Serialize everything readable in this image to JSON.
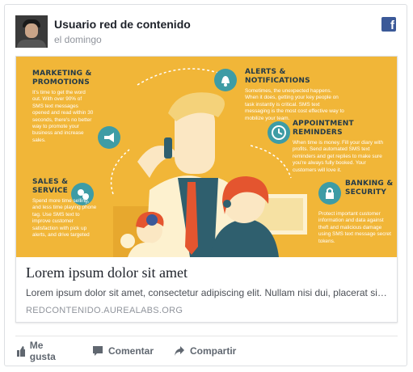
{
  "post": {
    "author": "Usuario red de contenido",
    "date": "el domingo"
  },
  "infographic": {
    "marketing_title": "MARKETING &\nPROMOTIONS",
    "marketing_text": "It's time to get the word out. With over 90% of SMS text messages opened and read within 30 seconds, there's no better way to promote your business and increase sales.",
    "alerts_title": "ALERTS & NOTIFICATIONS",
    "alerts_text": "Sometimes, the unexpected happens. When it does, getting your key people on task instantly is critical. SMS text messaging is the most cost effective way to mobilize your team.",
    "appointment_title": "APPOINTMENT REMINDERS",
    "appointment_text": "When time is money. Fill your diary with profits. Send automated SMS text reminders and get replies to make sure you're always fully booked. Your customers will love it.",
    "sales_title": "SALES &\nSERVICE",
    "sales_text": "Spend more time selling, and less time playing phone tag. Use SMS text to improve customer satisfaction with pick up alerts, and drive targeted",
    "banking_title": "BANKING &\nSECURITY",
    "banking_text": "Protect important customer information and data against theft and malicious damage using SMS text message secret tokens."
  },
  "link": {
    "title": "Lorem ipsum dolor sit amet",
    "description": "Lorem ipsum dolor sit amet, consectetur adipiscing elit. Nullam nisi dui, placerat sit amet",
    "domain": "REDCONTENIDO.AUREALABS.ORG"
  },
  "actions": {
    "like": "Me gusta",
    "comment": "Comentar",
    "share": "Compartir"
  },
  "colors": {
    "infographic_bg": "#f1b638",
    "accent_teal": "#3e9ca5",
    "facebook_blue": "#3b5998"
  }
}
